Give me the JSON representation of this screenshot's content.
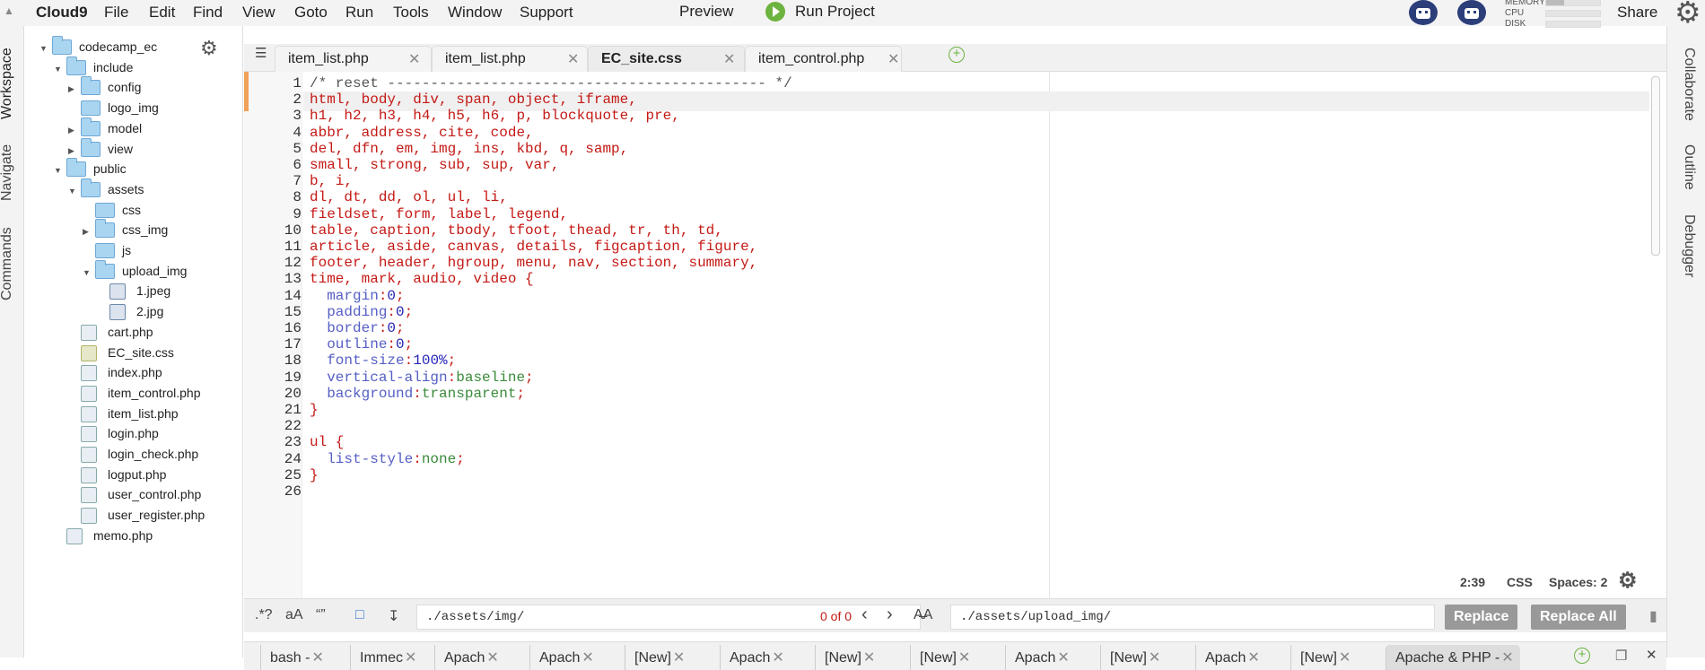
{
  "menubar": {
    "brand": "Cloud9",
    "items": [
      "File",
      "Edit",
      "Find",
      "View",
      "Goto",
      "Run",
      "Tools",
      "Window",
      "Support"
    ],
    "preview": "Preview",
    "run_project": "Run Project",
    "meters": [
      "MEMORY",
      "CPU",
      "DISK"
    ],
    "share": "Share"
  },
  "left_panels": [
    "Workspace",
    "Navigate",
    "Commands"
  ],
  "right_panels": [
    "Collaborate",
    "Outline",
    "Debugger"
  ],
  "tree": [
    {
      "label": "codecamp_ec",
      "depth": 0,
      "type": "folder",
      "state": "open"
    },
    {
      "label": "include",
      "depth": 1,
      "type": "folder",
      "state": "open"
    },
    {
      "label": "config",
      "depth": 2,
      "type": "folder",
      "state": "closed"
    },
    {
      "label": "logo_img",
      "depth": 2,
      "type": "folder",
      "state": "none"
    },
    {
      "label": "model",
      "depth": 2,
      "type": "folder",
      "state": "closed"
    },
    {
      "label": "view",
      "depth": 2,
      "type": "folder",
      "state": "closed"
    },
    {
      "label": "public",
      "depth": 1,
      "type": "folder",
      "state": "open"
    },
    {
      "label": "assets",
      "depth": 2,
      "type": "folder",
      "state": "open"
    },
    {
      "label": "css",
      "depth": 3,
      "type": "folder",
      "state": "none"
    },
    {
      "label": "css_img",
      "depth": 3,
      "type": "folder",
      "state": "closed"
    },
    {
      "label": "js",
      "depth": 3,
      "type": "folder",
      "state": "none"
    },
    {
      "label": "upload_img",
      "depth": 3,
      "type": "folder",
      "state": "open"
    },
    {
      "label": "1.jpeg",
      "depth": 4,
      "type": "img"
    },
    {
      "label": "2.jpg",
      "depth": 4,
      "type": "img"
    },
    {
      "label": "cart.php",
      "depth": 2,
      "type": "php"
    },
    {
      "label": "EC_site.css",
      "depth": 2,
      "type": "css"
    },
    {
      "label": "index.php",
      "depth": 2,
      "type": "php"
    },
    {
      "label": "item_control.php",
      "depth": 2,
      "type": "php"
    },
    {
      "label": "item_list.php",
      "depth": 2,
      "type": "php"
    },
    {
      "label": "login.php",
      "depth": 2,
      "type": "php"
    },
    {
      "label": "login_check.php",
      "depth": 2,
      "type": "php"
    },
    {
      "label": "logput.php",
      "depth": 2,
      "type": "php"
    },
    {
      "label": "user_control.php",
      "depth": 2,
      "type": "php"
    },
    {
      "label": "user_register.php",
      "depth": 2,
      "type": "php"
    },
    {
      "label": "memo.php",
      "depth": 1,
      "type": "php"
    }
  ],
  "tabs": [
    {
      "label": "item_list.php",
      "active": false
    },
    {
      "label": "item_list.php",
      "active": false
    },
    {
      "label": "EC_site.css",
      "active": true
    },
    {
      "label": "item_control.php",
      "active": false
    }
  ],
  "code_lines": [
    "/* reset -------------------------------------------- */",
    "html, body, div, span, object, iframe,",
    "h1, h2, h3, h4, h5, h6, p, blockquote, pre,",
    "abbr, address, cite, code,",
    "del, dfn, em, img, ins, kbd, q, samp,",
    "small, strong, sub, sup, var,",
    "b, i,",
    "dl, dt, dd, ol, ul, li,",
    "fieldset, form, label, legend,",
    "table, caption, tbody, tfoot, thead, tr, th, td,",
    "article, aside, canvas, details, figcaption, figure,",
    "footer, header, hgroup, menu, nav, section, summary,",
    "time, mark, audio, video {",
    "  margin:0;",
    "  padding:0;",
    "  border:0;",
    "  outline:0;",
    "  font-size:100%;",
    "  vertical-align:baseline;",
    "  background:transparent;",
    "}",
    "",
    "ul {",
    "  list-style:none;",
    "}"
  ],
  "status": {
    "cursor": "2:39",
    "mode": "CSS",
    "spaces": "Spaces: 2"
  },
  "find": {
    "regex": ".*?",
    "case": "aA",
    "word": "“”",
    "find_value": "./assets/img/",
    "count": "0 of 0",
    "preserve": "A̶A",
    "replace_value": "./assets/upload_img/",
    "replace": "Replace",
    "replace_all": "Replace All"
  },
  "terminal_tabs": [
    "bash -",
    "Immec",
    "Apach",
    "Apach",
    "[New]",
    "Apach",
    "[New]",
    "[New]",
    "Apach",
    "[New]",
    "Apach",
    "[New]",
    "Apache & PHP -"
  ]
}
